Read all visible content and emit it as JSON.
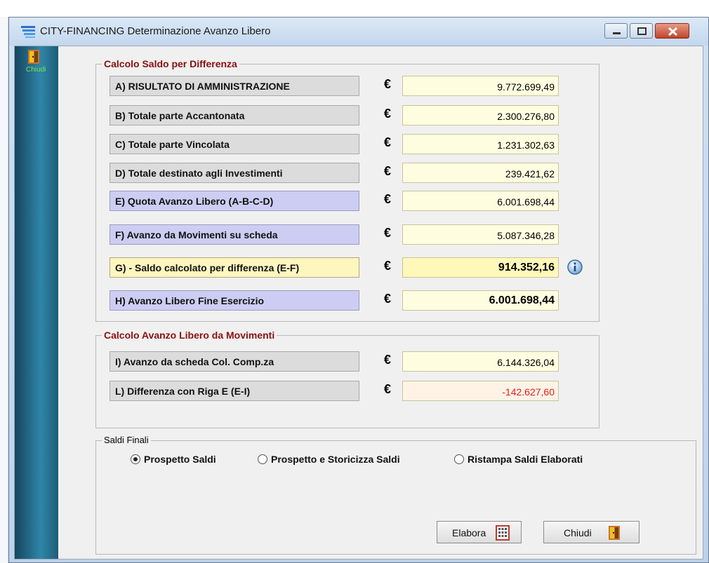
{
  "window": {
    "title": "CITY-FINANCING  Determinazione Avanzo Libero"
  },
  "sidebar": {
    "close_label": "Chiudi"
  },
  "section1": {
    "title": "Calcolo Saldo per Differenza",
    "rows": [
      {
        "label": "A) RISULTATO DI AMMINISTRAZIONE",
        "currency": "€",
        "value": "9.772.699,49"
      },
      {
        "label": "B) Totale parte Accantonata",
        "currency": "€",
        "value": "2.300.276,80"
      },
      {
        "label": "C) Totale parte Vincolata",
        "currency": "€",
        "value": "1.231.302,63"
      },
      {
        "label": "D) Totale destinato agli Investimenti",
        "currency": "€",
        "value": "239.421,62"
      },
      {
        "label": "E) Quota Avanzo Libero (A-B-C-D)",
        "currency": "€",
        "value": "6.001.698,44"
      },
      {
        "label": "F) Avanzo da Movimenti su scheda",
        "currency": "€",
        "value": "5.087.346,28"
      },
      {
        "label": "G) - Saldo calcolato per differenza (E-F)",
        "currency": "€",
        "value": "914.352,16"
      },
      {
        "label": "H) Avanzo Libero Fine Esercizio",
        "currency": "€",
        "value": "6.001.698,44"
      }
    ]
  },
  "section2": {
    "title": "Calcolo Avanzo Libero da Movimenti",
    "rows": [
      {
        "label": "I) Avanzo da scheda Col. Comp.za",
        "currency": "€",
        "value": "6.144.326,04"
      },
      {
        "label": "L) Differenza con Riga E (E-I)",
        "currency": "€",
        "value": "-142.627,60"
      }
    ]
  },
  "section3": {
    "title": "Saldi Finali",
    "options": [
      {
        "label": "Prospetto Saldi",
        "selected": true
      },
      {
        "label": "Prospetto e Storicizza Saldi",
        "selected": false
      },
      {
        "label": "Ristampa Saldi Elaborati",
        "selected": false
      }
    ],
    "elabora_label": "Elabora",
    "chiudi_label": "Chiudi"
  },
  "colors": {
    "legend_red": "#8b1010",
    "negative_value": "#e02020",
    "sidebar_teal": "#2f86a8",
    "sidebar_close_label": "#7ee24a"
  },
  "icons": {
    "app": "list-lines-icon",
    "close_door": "exit-door-icon",
    "info": "info-icon",
    "elabora": "calculator-icon"
  }
}
